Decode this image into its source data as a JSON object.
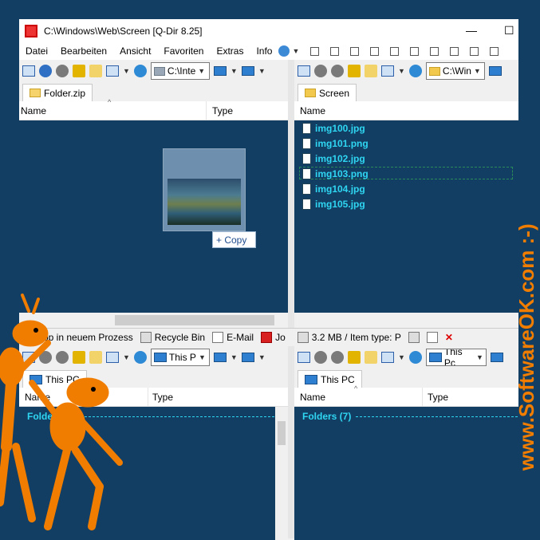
{
  "window": {
    "title": "C:\\Windows\\Web\\Screen  [Q-Dir 8.25]",
    "controls": [
      "—",
      "☐"
    ]
  },
  "menu": [
    "Datei",
    "Bearbeiten",
    "Ansicht",
    "Favoriten",
    "Extras",
    "Info"
  ],
  "pane_top_left": {
    "address": "C:\\Inte",
    "tab": "Folder.zip",
    "columns": [
      "Name",
      "Type"
    ],
    "drag_badge": "+ Copy"
  },
  "pane_top_right": {
    "address": "C:\\Win",
    "tab": "Screen",
    "columns": [
      "Name"
    ],
    "files": [
      "img100.jpg",
      "img101.png",
      "img102.jpg",
      "img103.png",
      "img104.jpg",
      "img105.jpg"
    ]
  },
  "statusbar": {
    "items": [
      "op in neuem Prozess",
      "Recycle Bin",
      "E-Mail",
      "Jo",
      "3.2 MB / Item type: P"
    ]
  },
  "pane_bottom_left": {
    "address": "This P",
    "tab": "This PC",
    "columns": [
      "Name",
      "Type"
    ],
    "group": "Folders ("
  },
  "pane_bottom_right": {
    "address": "This Pc",
    "tab": "This PC",
    "columns": [
      "Name",
      "Type"
    ],
    "group": "Folders (7)"
  },
  "branding": {
    "text": "www.SoftwareOK.com :-)",
    "color": "#f07d00"
  }
}
